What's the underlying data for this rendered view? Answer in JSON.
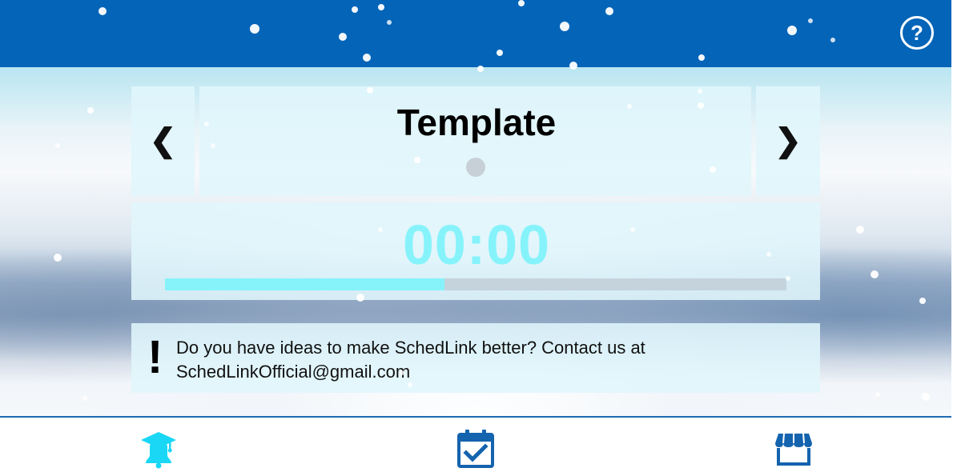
{
  "header": {
    "help_label": "?"
  },
  "template_nav": {
    "prev_label": "❮",
    "next_label": "❯",
    "title": "Template"
  },
  "timer": {
    "display": "00:00",
    "progress_fraction": 0.45
  },
  "notice": {
    "icon_label": "!",
    "line1": "Do you have ideas to make SchedLink better? Contact us at",
    "line2": "SchedLinkOfficial@gmail.com"
  },
  "bottom_nav": {
    "items": [
      {
        "icon": "graduation-bell-icon",
        "color": "#19d7f5"
      },
      {
        "icon": "calendar-check-icon",
        "color": "#1463ae"
      },
      {
        "icon": "storefront-icon",
        "color": "#1463ae"
      }
    ]
  },
  "colors": {
    "topbar": "#0364b8",
    "accent_cyan": "#86f3fb",
    "nav_blue": "#1463ae"
  }
}
